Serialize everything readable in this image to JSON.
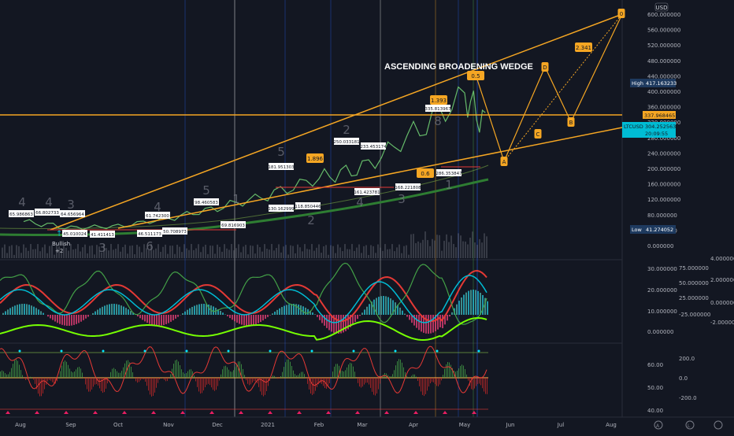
{
  "chart_data": {
    "type": "line",
    "title": "ASCENDING BROADENING WEDGE",
    "symbol": "LTCUSD",
    "currency": "USD",
    "price_axis": {
      "ticks": [
        "600.000000",
        "560.000000",
        "520.000000",
        "480.000000",
        "440.000000",
        "400.000000",
        "360.000000",
        "320.000000",
        "280.000000",
        "240.000000",
        "200.000000",
        "160.000000",
        "120.000000",
        "80.000000",
        "40.000000",
        "0.000000"
      ]
    },
    "markers": {
      "high_label": "High",
      "high_value": "417.163233",
      "low_label": "Low",
      "low_value": "41.274052",
      "resistance_value": "337.968465",
      "current_value": "304.252563",
      "countdown": "20:09:55"
    },
    "x_axis": {
      "labels": [
        "Aug",
        "Sep",
        "Oct",
        "Nov",
        "Dec",
        "2021",
        "Feb",
        "Mar",
        "Apr",
        "May",
        "Jun",
        "Jul",
        "Aug"
      ]
    },
    "price_series": {
      "months": [
        "Aug",
        "Sep",
        "Oct",
        "Nov",
        "Dec",
        "2021",
        "Feb",
        "Mar",
        "Apr",
        "May"
      ],
      "values": [
        62,
        46,
        50,
        70,
        98,
        130,
        175,
        200,
        290,
        390
      ],
      "ylim": [
        0,
        620
      ]
    },
    "wedge": {
      "upper_line": [
        [
          64,
          330
        ],
        [
          440,
          175
        ],
        [
          560,
          150
        ],
        [
          605,
          98
        ],
        [
          790,
          18
        ]
      ],
      "lower_line": [
        [
          150,
          290
        ],
        [
          640,
          205
        ],
        [
          790,
          165
        ]
      ],
      "resistance": 337.97
    },
    "projection_labels": [
      "D",
      "B",
      "C",
      "A",
      "0",
      "2.341",
      "0.5",
      "1.896",
      "1.393",
      "0.6"
    ],
    "price_labels": [
      "65.986863",
      "66.802733",
      "64.656964",
      "45.010024",
      "41.411413",
      "46.511173",
      "61.742300",
      "50.708973",
      "98.460583",
      "69.816903",
      "181.951303",
      "130.162999",
      "118.850446",
      "250.033181",
      "233.453174",
      "161.423781",
      "335.813967",
      "168.221808",
      "286.353847"
    ],
    "wave_counts": [
      "4",
      "4",
      "3",
      "4",
      "5",
      "3",
      "2",
      "1",
      "2",
      "3",
      "4",
      "1",
      "5",
      "8",
      "6"
    ],
    "signal_text": [
      "Bullish",
      "+2"
    ],
    "osc1_axis": {
      "left": [
        "30.000000",
        "20.000000",
        "10.000000",
        "0.000000"
      ],
      "mid": [
        "75.000000",
        "50.000000",
        "25.000000",
        "-25.000000"
      ],
      "right": [
        "4.000000",
        "2.000000",
        "0.000000",
        "-2.000000"
      ]
    },
    "osc2_axis": {
      "left": [
        "60.00",
        "50.00",
        "40.00"
      ],
      "right": [
        "200.0",
        "0.0",
        "-200.0"
      ]
    },
    "colors": {
      "background": "#131722",
      "wedge": "#f5a623",
      "green_line": "#2e7d32",
      "red_line": "#e53935",
      "cyan": "#00bcd4",
      "orange_label": "#f5a623"
    }
  }
}
